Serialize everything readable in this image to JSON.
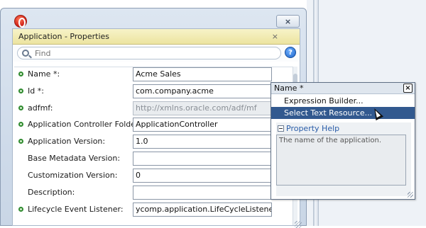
{
  "window": {
    "panel_title": "Application - Properties",
    "close_glyph": "×",
    "panel_close_glyph": "×"
  },
  "search": {
    "placeholder": "Find"
  },
  "help_glyph": "?",
  "properties": [
    {
      "label": "Name *:",
      "value": "Acme Sales",
      "required": true,
      "disabled": false
    },
    {
      "label": "Id *:",
      "value": "com.company.acme",
      "required": true,
      "disabled": false
    },
    {
      "label": "adfmf:",
      "value": "http://xmlns.oracle.com/adf/mf",
      "required": true,
      "disabled": true
    },
    {
      "label": "Application Controller Folder:",
      "value": "ApplicationController",
      "required": true,
      "disabled": false
    },
    {
      "label": "Application Version:",
      "value": "1.0",
      "required": true,
      "disabled": false
    },
    {
      "label": "Base Metadata Version:",
      "value": "",
      "required": false,
      "disabled": false
    },
    {
      "label": "Customization Version:",
      "value": "0",
      "required": false,
      "disabled": false
    },
    {
      "label": "Description:",
      "value": "",
      "required": false,
      "disabled": false
    },
    {
      "label": "Lifecycle Event Listener:",
      "value": "ycomp.application.LifeCycleListenerImpl",
      "required": true,
      "disabled": false
    }
  ],
  "popup": {
    "title": "Name *",
    "close_glyph": "×",
    "menu": [
      {
        "label": "Expression Builder...",
        "selected": false
      },
      {
        "label": "Select Text Resource...",
        "selected": true
      }
    ],
    "help_header": "Property Help",
    "help_text": "The name of the application."
  },
  "colors": {
    "selection": "#32598f",
    "required_dot": "#2f8a2f",
    "panel_header": "#ece4a0"
  }
}
